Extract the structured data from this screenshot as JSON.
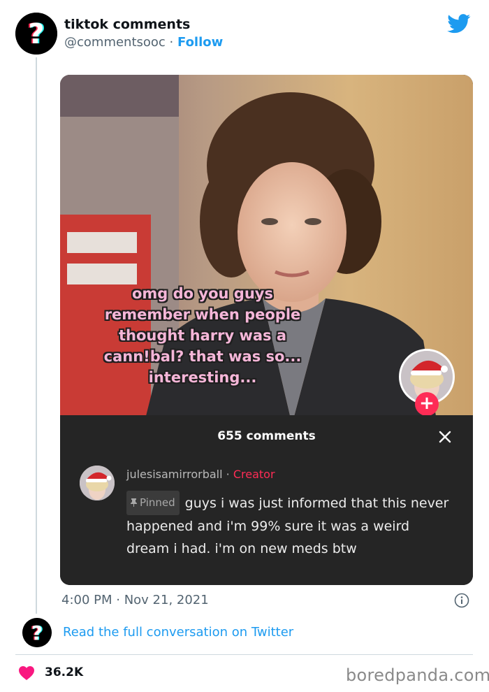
{
  "tweet": {
    "display_name": "tiktok comments",
    "handle": "@commentsooc",
    "separator": " · ",
    "follow_label": "Follow",
    "timestamp": "4:00 PM · Nov 21, 2021",
    "read_link": "Read the full conversation on Twitter",
    "likes": "36.2K"
  },
  "tiktok": {
    "caption_lines": [
      "omg do you guys",
      "remember when people",
      "thought harry was a",
      "cann!bal? that was so...",
      "interesting..."
    ],
    "plus_label": "+",
    "comments_count": "655 comments",
    "comment": {
      "username": "julesisamirrorball",
      "separator": " · ",
      "creator_label": "Creator",
      "pinned_label": "Pinned",
      "text": "guys i was just informed that this never happened and i'm 99% sure it was a weird dream i had. i'm on new meds btw"
    }
  },
  "watermark": "boredpanda.com",
  "colors": {
    "twitter_blue": "#1d9bf0",
    "tiktok_red": "#fe2c55",
    "panel_bg": "#252525",
    "heart": "#f91880"
  },
  "icons": [
    "tiktok-question-logo",
    "twitter-bird-icon",
    "close-icon",
    "pin-icon",
    "info-icon",
    "heart-icon"
  ]
}
